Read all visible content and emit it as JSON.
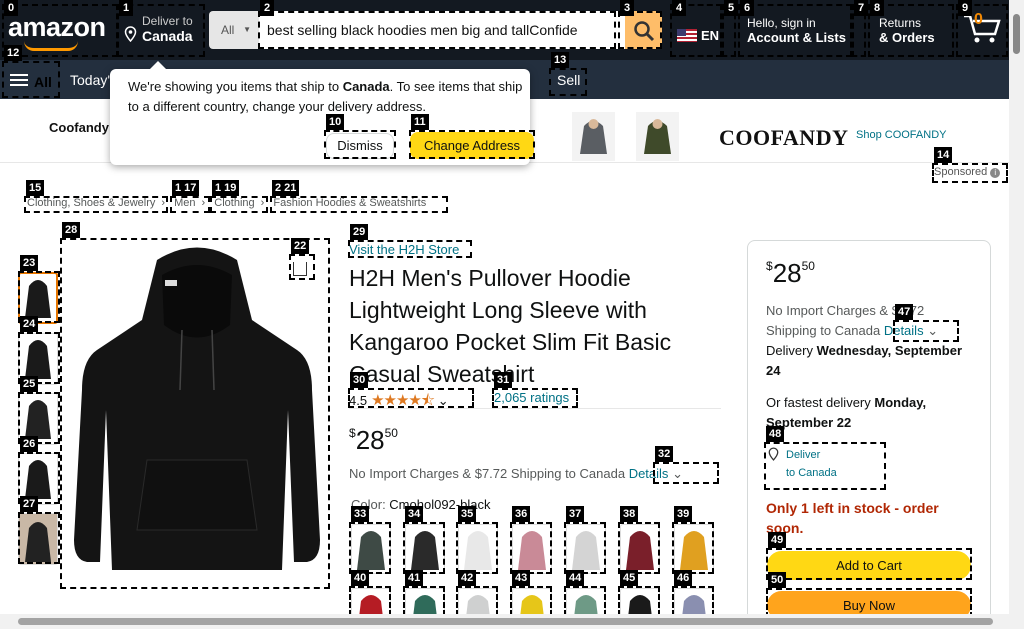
{
  "header": {
    "logo": "amazon",
    "deliver_label": "Deliver to",
    "deliver_country": "Canada",
    "search_category": "All",
    "search_value": "best selling black hoodies men big and tallConfide",
    "lang": "EN",
    "account_line1": "Hello, sign in",
    "account_line2": "Account & Lists",
    "orders_line1": "Returns",
    "orders_line2": "& Orders",
    "cart_count": "0"
  },
  "subnav": {
    "all_label": "All",
    "todays": "Today's",
    "sell": "Sell"
  },
  "popup": {
    "message_pre": "We're showing you items that ship to ",
    "message_country": "Canada",
    "message_post": ". To see items that ship to a different country, change your delivery address.",
    "dismiss": "Dismiss",
    "change": "Change Address"
  },
  "brand": {
    "name": "Coofandy",
    "logo": "COOFANDY",
    "shop": "Shop COOFANDY",
    "sponsored": "Sponsored"
  },
  "breadcrumb": [
    "Clothing, Shoes & Jewelry",
    "Men",
    "Clothing",
    "Fashion Hoodies & Sweatshirts"
  ],
  "product": {
    "store": "Visit the H2H Store",
    "title": "H2H Men's Pullover Hoodie Lightweight Long Sleeve with Kangaroo Pocket Slim Fit Basic Casual Sweatshirt",
    "rating": "4.5",
    "stars": "★★★★⯪",
    "ratings": "2,065 ratings",
    "price_symbol": "$",
    "price_whole": "28",
    "price_fraction": "50",
    "import_text": "No Import Charges & $7.72 Shipping to Canada",
    "details": "Details",
    "color_label": "Color: ",
    "color_value": "Cmohol092-black"
  },
  "buybox": {
    "price_symbol": "$",
    "price_whole": "28",
    "price_fraction": "50",
    "import_text": "No Import Charges & $7.72 Shipping to Canada",
    "details": "Details",
    "delivery_pre": "Delivery ",
    "delivery_date": "Wednesday, September 24",
    "fastest_pre": "Or fastest delivery ",
    "fastest_date": "Monday, September 22",
    "deliver_to_1": "Deliver",
    "deliver_to_2": "to Canada",
    "stock": "Only 1 left in stock - order soon.",
    "add_to_cart": "Add to Cart",
    "buy_now": "Buy Now"
  },
  "annotation_labels": [
    "0",
    "1",
    "2",
    "3",
    "4",
    "5",
    "6",
    "7",
    "8",
    "9",
    "10",
    "11",
    "12",
    "13",
    "14",
    "15",
    "1 17",
    "1 19",
    "2 21",
    "22",
    "23",
    "24",
    "25",
    "26",
    "27",
    "28",
    "29",
    "30",
    "31",
    "32",
    "33",
    "34",
    "35",
    "36",
    "37",
    "38",
    "39",
    "40",
    "41",
    "42",
    "43",
    "44",
    "45",
    "46",
    "47",
    "48",
    "49",
    "50"
  ],
  "colors": {
    "topbar": "#131921",
    "subbar": "#232f3e",
    "search_button": "#febd69",
    "link": "#007185",
    "add_to_cart": "#ffd814",
    "buy_now": "#ffa41c",
    "stock_red": "#b12704",
    "star": "#de7921"
  },
  "swatch_colors": [
    "#3e4a45",
    "#2a2a2a",
    "#e8e8e8",
    "#c98a97",
    "#d4d4d4",
    "#7a1f2a",
    "#e0a020",
    "#b51c24",
    "#2f6b5a",
    "#cfd0d0",
    "#e6c619",
    "#6e9a86",
    "#1a1a1a",
    "#8a8fb0"
  ]
}
